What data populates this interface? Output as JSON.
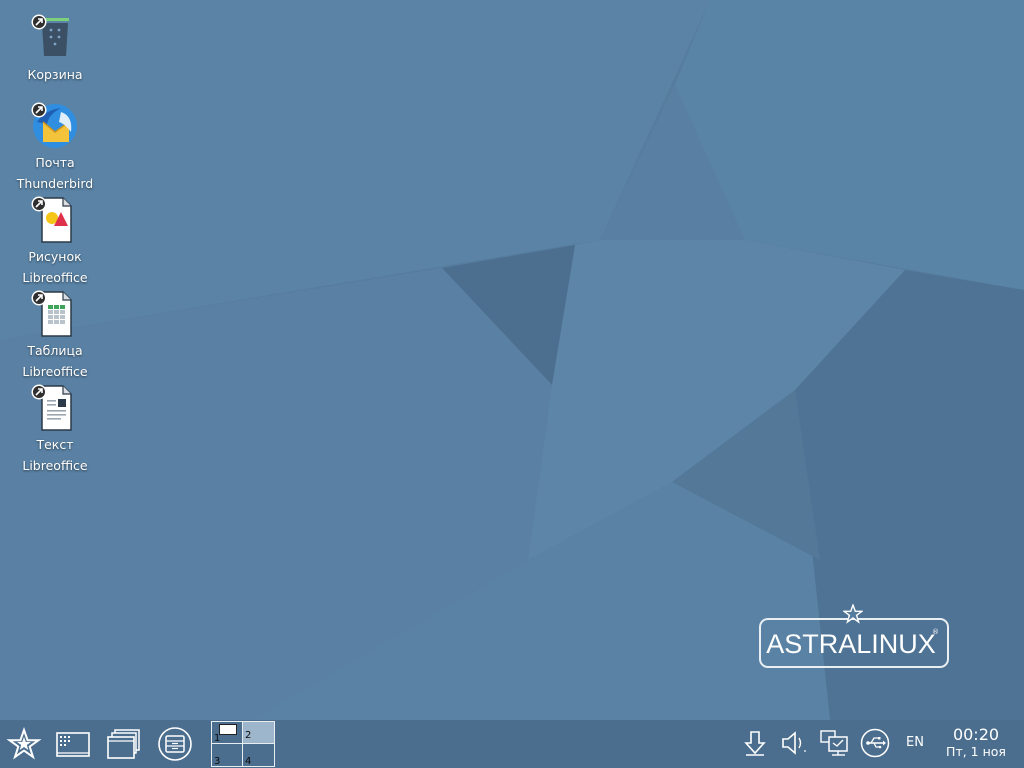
{
  "desktop": {
    "icons": [
      {
        "label_line1": "Корзина",
        "label_line2": "",
        "icon": "trash-icon"
      },
      {
        "label_line1": "Почта",
        "label_line2": "Thunderbird",
        "icon": "thunderbird-mail-icon"
      },
      {
        "label_line1": "Рисунок",
        "label_line2": "Libreoffice",
        "icon": "libreoffice-draw-icon"
      },
      {
        "label_line1": "Таблица",
        "label_line2": "Libreoffice",
        "icon": "libreoffice-calc-icon"
      },
      {
        "label_line1": "Текст",
        "label_line2": "Libreoffice",
        "icon": "libreoffice-writer-icon"
      }
    ],
    "logo": {
      "text": "ASTRALINUX",
      "registered": "®"
    }
  },
  "taskbar": {
    "start_icon": "astra-star-icon",
    "launcher_icons": [
      "app-menu-icon",
      "windows-overview-icon",
      "file-manager-icon"
    ],
    "pager": {
      "workspaces": [
        "1",
        "2",
        "3",
        "4"
      ],
      "active_workspace": "2"
    },
    "tray_icons": [
      "download-icon",
      "volume-icon",
      "display-icon",
      "usb-icon"
    ],
    "language": "EN",
    "clock": {
      "time": "00:20",
      "date": "Пт, 1 ноя"
    }
  },
  "colors": {
    "desktop_bg": "#577d9e",
    "taskbar_bg": "#4b6e8f",
    "active_workspace": "#9eb6cb",
    "text": "#ffffff"
  }
}
